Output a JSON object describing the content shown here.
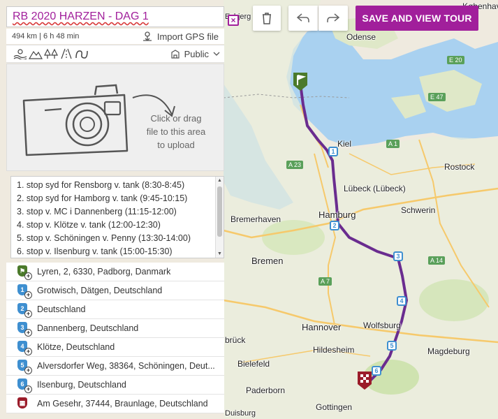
{
  "tour": {
    "title": "RB 2020 HARZEN - DAG 1",
    "stats": "494 km | 6 h 48 min",
    "import_gps_label": "Import GPS file",
    "visibility": "Public"
  },
  "upload": {
    "text_line1": "Click or drag",
    "text_line2": "file to this area",
    "text_line3": "to upload"
  },
  "notes": [
    "1. stop syd for Rensborg v. tank (8:30-8:45)",
    "2. stop syd for Hamborg v. tank (9:45-10:15)",
    "3. stop v. MC i Dannenberg (11:15-12:00)",
    "4. stop v. Klötze v. tank (12:00-12:30)",
    "5. stop v. Schöningen v. Penny (13:30-14:00)",
    "6. stop v. Ilsenburg v. tank (15:00-15:30)"
  ],
  "waypoints": [
    {
      "marker": "flag",
      "label": "Lyren, 2, 6330, Padborg, Danmark",
      "color": "#4b7a2b"
    },
    {
      "marker": "1",
      "label": "Grotwisch, Dätgen, Deutschland",
      "color": "#3e8fd0"
    },
    {
      "marker": "2",
      "label": "Deutschland",
      "color": "#3e8fd0"
    },
    {
      "marker": "3",
      "label": "Dannenberg, Deutschland",
      "color": "#3e8fd0"
    },
    {
      "marker": "4",
      "label": "Klötze, Deutschland",
      "color": "#3e8fd0"
    },
    {
      "marker": "5",
      "label": "Alversdorfer Weg, 38364, Schöningen, Deut...",
      "color": "#3e8fd0"
    },
    {
      "marker": "6",
      "label": "Ilsenburg, Deutschland",
      "color": "#3e8fd0"
    },
    {
      "marker": "finish",
      "label": "Am Gesehr, 37444, Braunlage, Deutschland",
      "color": "#9b1c2a"
    }
  ],
  "toolbar": {
    "save_label": "SAVE AND VIEW TOUR"
  },
  "map": {
    "labels": {
      "odense": "Odense",
      "kobenhavn": "Københav",
      "esbjerg": "Esbjerg",
      "kiel": "Kiel",
      "rostock": "Rostock",
      "lubeck": "Lübeck (Lübeck)",
      "schwerin": "Schwerin",
      "bremerhaven": "Bremerhaven",
      "hamburg": "Hamburg",
      "bremen": "Bremen",
      "hannover": "Hannover",
      "wolfsburg": "Wolfsburg",
      "bruck": "brück",
      "hildesheim": "Hildesheim",
      "magdeburg": "Magdeburg",
      "bielefeld": "Bielefeld",
      "paderborn": "Paderborn",
      "gottingen": "Gottingen",
      "duisburg": "Duisburg"
    },
    "roads": {
      "a1": "A 1",
      "a23": "A 23",
      "a7": "A 7",
      "a14": "A 14",
      "e47": "E 47",
      "e20": "E 20"
    },
    "route_color": "#6a2c8f"
  }
}
